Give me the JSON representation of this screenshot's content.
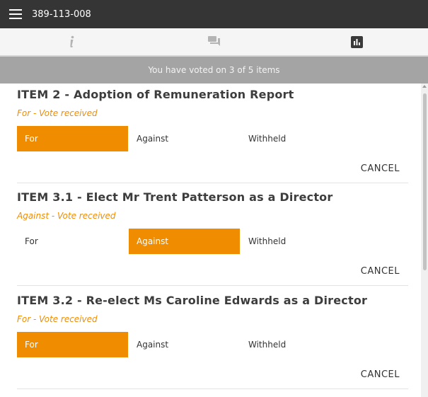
{
  "header": {
    "meeting_id": "389-113-008"
  },
  "tabs": [
    {
      "icon": "info-icon",
      "label": ""
    },
    {
      "icon": "chat-icon",
      "label": ""
    },
    {
      "icon": "chart-icon",
      "label": ""
    }
  ],
  "status": {
    "text": "You have voted on 3 of 5 items"
  },
  "items": [
    {
      "title": "ITEM 2 - Adoption of Remuneration Report",
      "vote_status": "For - Vote received",
      "options": [
        "For",
        "Against",
        "Withheld"
      ],
      "selected": "For",
      "cancel": "CANCEL"
    },
    {
      "title": "ITEM 3.1 - Elect Mr Trent Patterson as a Director",
      "vote_status": "Against - Vote received",
      "options": [
        "For",
        "Against",
        "Withheld"
      ],
      "selected": "Against",
      "cancel": "CANCEL"
    },
    {
      "title": "ITEM 3.2 - Re-elect Ms Caroline Edwards as a Director",
      "vote_status": "For - Vote received",
      "options": [
        "For",
        "Against",
        "Withheld"
      ],
      "selected": "For",
      "cancel": "CANCEL"
    }
  ],
  "colors": {
    "accent": "#f08c00",
    "topbar": "#353535",
    "status_bar": "#a4a4a4"
  }
}
